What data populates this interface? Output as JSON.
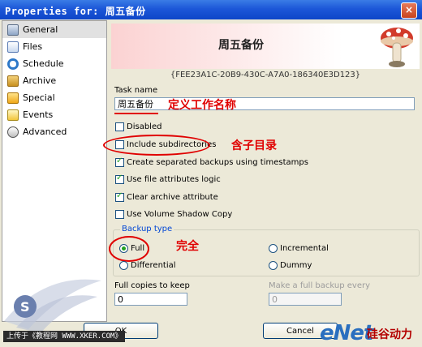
{
  "window": {
    "title": "Properties for: 周五备份",
    "close_label": "×"
  },
  "sidebar": {
    "items": [
      {
        "label": "General",
        "icon": "general-icon",
        "active": true
      },
      {
        "label": "Files",
        "icon": "files-icon"
      },
      {
        "label": "Schedule",
        "icon": "schedule-icon"
      },
      {
        "label": "Archive",
        "icon": "archive-icon"
      },
      {
        "label": "Special",
        "icon": "special-icon"
      },
      {
        "label": "Events",
        "icon": "events-icon"
      },
      {
        "label": "Advanced",
        "icon": "advanced-icon"
      }
    ]
  },
  "header": {
    "title": "周五备份",
    "guid": "{FEE23A1C-20B9-430C-A7A0-186340E3D123}"
  },
  "form": {
    "task_name_label": "Task name",
    "task_name_value": "周五备份",
    "checkboxes": [
      {
        "label": "Disabled",
        "checked": false
      },
      {
        "label": "Include subdirectories",
        "checked": false
      },
      {
        "label": "Create separated backups using timestamps",
        "checked": true
      },
      {
        "label": "Use file attributes logic",
        "checked": true
      },
      {
        "label": "Clear archive attribute",
        "checked": true
      },
      {
        "label": "Use Volume Shadow Copy",
        "checked": false
      }
    ],
    "backup_type": {
      "label": "Backup type",
      "options": [
        "Full",
        "Incremental",
        "Differential",
        "Dummy"
      ],
      "selected": "Full"
    },
    "full_copies_label": "Full copies to keep",
    "full_copies_value": "0",
    "make_full_label": "Make a full backup every",
    "make_full_value": "0"
  },
  "annotations": {
    "task_name_note": "定义工作名称",
    "subdir_note": "含子目录",
    "full_note": "完全"
  },
  "buttons": {
    "ok": "OK",
    "cancel": "Cancel"
  },
  "watermarks": {
    "footer": "上传于《教程网 WWW.XKER.COM》",
    "enet": "eNet",
    "enet_cn": "硅谷动力"
  },
  "colors": {
    "titlebar": "#1c57d8",
    "annotation": "#e00000",
    "accent_check": "#21a121"
  }
}
